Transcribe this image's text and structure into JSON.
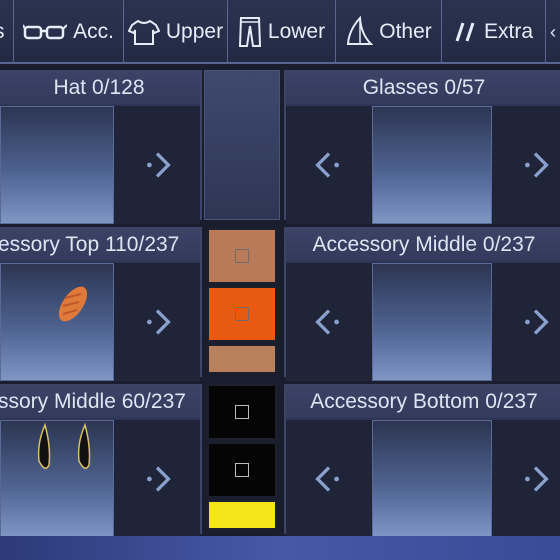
{
  "tabs": [
    {
      "label": "s",
      "icon": "shirt-partial-icon"
    },
    {
      "label": "Acc.",
      "icon": "glasses-icon"
    },
    {
      "label": "Upper",
      "icon": "tshirt-icon"
    },
    {
      "label": "Lower",
      "icon": "pants-icon"
    },
    {
      "label": "Other",
      "icon": "sail-icon"
    },
    {
      "label": "Extra",
      "icon": "slashes-icon"
    }
  ],
  "slots": {
    "hat": {
      "title": "Hat 0/128"
    },
    "glasses": {
      "title": "Glasses 0/57"
    },
    "acc_top": {
      "title": "essory Top 110/237"
    },
    "acc_middle_right": {
      "title": "Accessory Middle 0/237"
    },
    "acc_middle_left": {
      "title": "ssory Middle 60/237"
    },
    "acc_bottom": {
      "title": "Accessory Bottom 0/237"
    }
  },
  "swatches": {
    "top": [
      "#b87a58",
      "#e85a12",
      "#b8805c"
    ],
    "middle": [
      "#050505",
      "#050505",
      "#f4e41a"
    ]
  }
}
